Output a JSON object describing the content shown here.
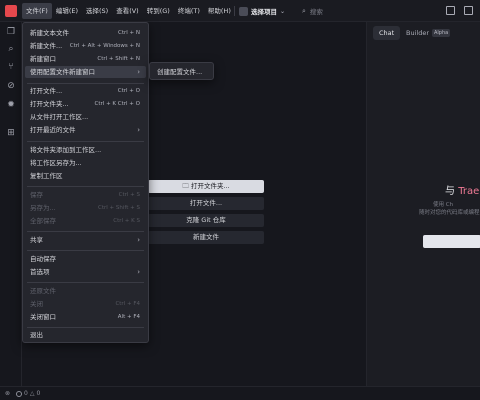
{
  "titlebar": {
    "menus": [
      "文件(F)",
      "编辑(E)",
      "选择(S)",
      "查看(V)",
      "转到(G)",
      "终端(T)",
      "帮助(H)"
    ],
    "active_menu": "文件(F)",
    "project_label": "选择项目",
    "search_placeholder": "搜索"
  },
  "file_menu": {
    "new_text_file": {
      "label": "新建文本文件",
      "shortcut": "Ctrl + N"
    },
    "new_file": {
      "label": "新建文件...",
      "shortcut": "Ctrl + Alt + Windows + N"
    },
    "new_window": {
      "label": "新建窗口",
      "shortcut": "Ctrl + Shift + N"
    },
    "new_window_profile": {
      "label": "使用配置文件新建窗口"
    },
    "open_file": {
      "label": "打开文件...",
      "shortcut": "Ctrl + O"
    },
    "open_folder": {
      "label": "打开文件夹...",
      "shortcut": "Ctrl + K   Ctrl + O"
    },
    "open_workspace": {
      "label": "从文件打开工作区..."
    },
    "open_recent": {
      "label": "打开最近的文件"
    },
    "add_folder_workspace": {
      "label": "将文件夹添加到工作区..."
    },
    "save_workspace_as": {
      "label": "将工作区另存为..."
    },
    "duplicate_workspace": {
      "label": "复制工作区"
    },
    "save": {
      "label": "保存",
      "shortcut": "Ctrl + S"
    },
    "save_as": {
      "label": "另存为...",
      "shortcut": "Ctrl + Shift + S"
    },
    "save_all": {
      "label": "全部保存",
      "shortcut": "Ctrl + K   S"
    },
    "share": {
      "label": "共享"
    },
    "auto_save": {
      "label": "自动保存"
    },
    "preferences": {
      "label": "首选项"
    },
    "revert_file": {
      "label": "还原文件"
    },
    "close": {
      "label": "关闭",
      "shortcut": "Ctrl + F4"
    },
    "close_window": {
      "label": "关闭窗口",
      "shortcut": "Alt + F4"
    },
    "exit": {
      "label": "退出"
    }
  },
  "submenu": {
    "create_profile": "创建配置文件..."
  },
  "welcome": {
    "open_folder": "打开文件夹...",
    "open_file": "打开文件...",
    "clone_git": "克隆 Git 仓库",
    "new_file": "新建文件"
  },
  "panel": {
    "tab_chat": "Chat",
    "tab_builder": "Builder",
    "badge": "Alpha",
    "logo_prefix": "与",
    "logo_brand": "Trae",
    "line1": "使用 Ch",
    "line2": "随时对您的代码库或编程"
  },
  "status": {
    "errors": "0",
    "warnings": "0"
  },
  "colors": {
    "accent": "#e5484d",
    "brand_pink": "#ef7a95",
    "menu_bg": "#25262d",
    "editor_bg": "#16171d"
  }
}
